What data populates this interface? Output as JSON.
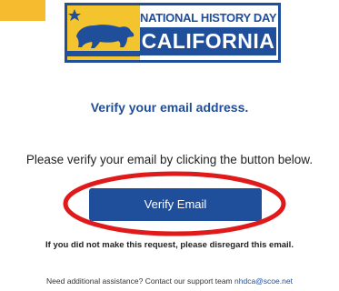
{
  "logo": {
    "line1": "NATIONAL HISTORY DAY",
    "line2": "CALIFORNIA",
    "icon": "california-bear-flag-icon"
  },
  "email": {
    "heading": "Verify your email address.",
    "instruction": "Please verify your email by clicking the button below.",
    "button_label": "Verify Email",
    "disregard_note": "If you did not make this request, please disregard this email.",
    "support_text": "Need additional assistance? Contact our support team",
    "support_email": "nhdca@scoe.net"
  },
  "colors": {
    "brand_blue": "#1f4e9a",
    "gold": "#f3c42d",
    "annotation_red": "#e01a1a"
  }
}
